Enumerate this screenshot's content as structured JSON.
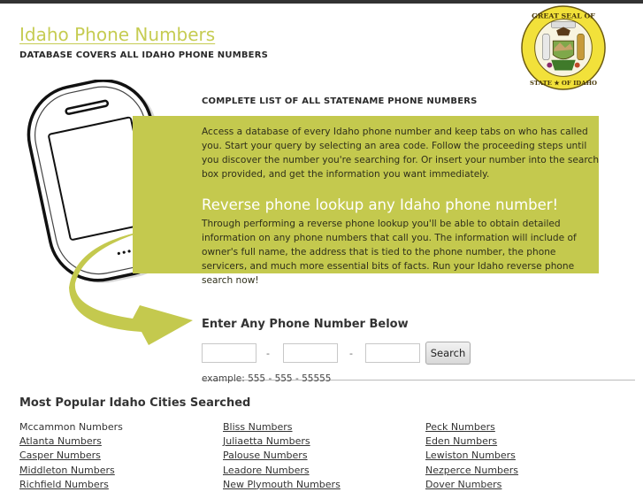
{
  "header": {
    "site_title": "Idaho Phone Numbers",
    "tagline": "DATABASE COVERS ALL IDAHO PHONE NUMBERS",
    "seal_text": "GREAT SEAL OF THE STATE OF IDAHO",
    "seal_icon": "idaho-state-seal"
  },
  "intro": {
    "heading": "COMPLETE LIST OF ALL STATENAME PHONE NUMBERS",
    "paragraph": "Access a database of every Idaho phone number and keep tabs on who has called you. Start your query by selecting an area code. Follow the proceeding steps until you discover the number you're searching for. Or insert your number into the search box provided, and get the information you want immediately.",
    "reverse_heading": "Reverse phone lookup any Idaho phone number!",
    "reverse_paragraph": "Through performing a reverse phone lookup you'll be able to obtain detailed information on any phone numbers that call you. The information will include of owner's full name, the address that is tied to the phone number, the phone servicers, and much more essential bits of facts. Run your Idaho reverse phone search now!"
  },
  "search_form": {
    "heading": "Enter Any Phone Number Below",
    "field1_value": "",
    "field2_value": "",
    "field3_value": "",
    "separator": "-",
    "button_label": "Search",
    "example": "example: 555 - 555 - 55555"
  },
  "cities": {
    "heading": "Most Popular Idaho Cities Searched",
    "columns": [
      [
        {
          "label": "Mccammon Numbers",
          "link": false
        },
        {
          "label": "Atlanta Numbers",
          "link": true
        },
        {
          "label": "Casper Numbers",
          "link": true
        },
        {
          "label": "Middleton Numbers",
          "link": true
        },
        {
          "label": "Richfield Numbers",
          "link": true
        }
      ],
      [
        {
          "label": "Bliss Numbers",
          "link": true
        },
        {
          "label": "Juliaetta Numbers",
          "link": true
        },
        {
          "label": "Palouse Numbers",
          "link": true
        },
        {
          "label": "Leadore Numbers",
          "link": true
        },
        {
          "label": "New Plymouth Numbers",
          "link": true
        }
      ],
      [
        {
          "label": "Peck Numbers",
          "link": true
        },
        {
          "label": "Eden Numbers",
          "link": true
        },
        {
          "label": "Lewiston Numbers",
          "link": true
        },
        {
          "label": "Nezperce Numbers",
          "link": true
        },
        {
          "label": "Dover Numbers",
          "link": true
        }
      ]
    ]
  },
  "colors": {
    "accent_green": "#c4c94e",
    "title_green": "#c6cc52",
    "top_bar": "#333333"
  }
}
